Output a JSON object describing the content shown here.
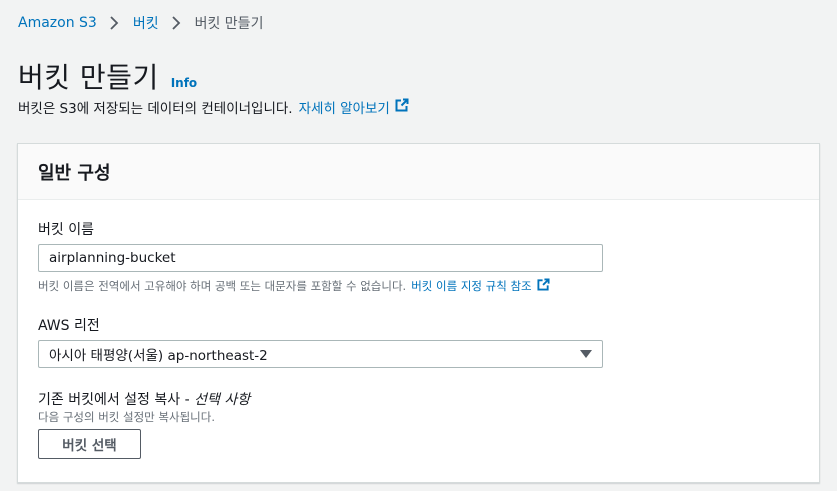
{
  "breadcrumb": {
    "items": [
      {
        "label": "Amazon S3"
      },
      {
        "label": "버킷"
      },
      {
        "label": "버킷 만들기"
      }
    ]
  },
  "page": {
    "title": "버킷 만들기",
    "info_label": "Info",
    "description": "버킷은 S3에 저장되는 데이터의 컨테이너입니다.",
    "learn_more": "자세히 알아보기"
  },
  "panel": {
    "header": "일반 구성",
    "bucket_name": {
      "label": "버킷 이름",
      "value": "airplanning-bucket",
      "hint": "버킷 이름은 전역에서 고유해야 하며 공백 또는 대문자를 포함할 수 없습니다.",
      "rules_link": "버킷 이름 지정 규칙 참조"
    },
    "region": {
      "label": "AWS 리전",
      "selected": "아시아 태평양(서울) ap-northeast-2"
    },
    "copy_settings": {
      "label": "기존 버킷에서 설정 복사 -",
      "label_optional": "선택 사항",
      "hint": "다음 구성의 버킷 설정만 복사됩니다.",
      "button": "버킷 선택"
    }
  },
  "icons": {
    "breadcrumb_separator": "chevron-right-icon",
    "external_link": "external-link-icon",
    "select_caret": "caret-down-icon"
  },
  "colors": {
    "link": "#0073bb",
    "background": "#f2f3f3",
    "text": "#16191f",
    "muted": "#687078"
  }
}
